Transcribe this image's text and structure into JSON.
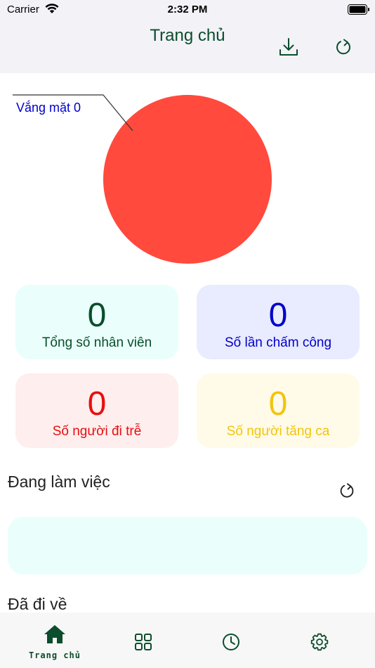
{
  "status_bar": {
    "carrier": "Carrier",
    "time": "2:32 PM"
  },
  "header": {
    "title": "Trang chủ",
    "download_icon": "download-icon",
    "refresh_icon": "refresh-icon"
  },
  "chart_data": {
    "type": "pie",
    "slices": [
      {
        "label": "Vắng mặt",
        "value": 0,
        "color": "#ff4a3d"
      }
    ],
    "annotation": "Vắng mặt 0"
  },
  "stats": {
    "total_employees": {
      "value": "0",
      "label": "Tổng số nhân viên"
    },
    "checkins": {
      "value": "0",
      "label": "Số lần chấm công"
    },
    "late": {
      "value": "0",
      "label": "Số người đi trễ"
    },
    "overtime": {
      "value": "0",
      "label": "Số người tăng ca"
    }
  },
  "sections": {
    "working": {
      "title": "Đang làm việc"
    },
    "left": {
      "title": "Đã đi về"
    }
  },
  "tabbar": {
    "home": {
      "label": "Trang chủ",
      "icon": "home-icon"
    },
    "grid": {
      "icon": "grid-icon"
    },
    "history": {
      "icon": "clock-icon"
    },
    "settings": {
      "icon": "gear-icon"
    }
  },
  "colors": {
    "brand": "#0b4d2c",
    "blue": "#0000cc",
    "red": "#e80f0f",
    "yellow": "#f2c40c",
    "pie": "#ff4a3d"
  }
}
